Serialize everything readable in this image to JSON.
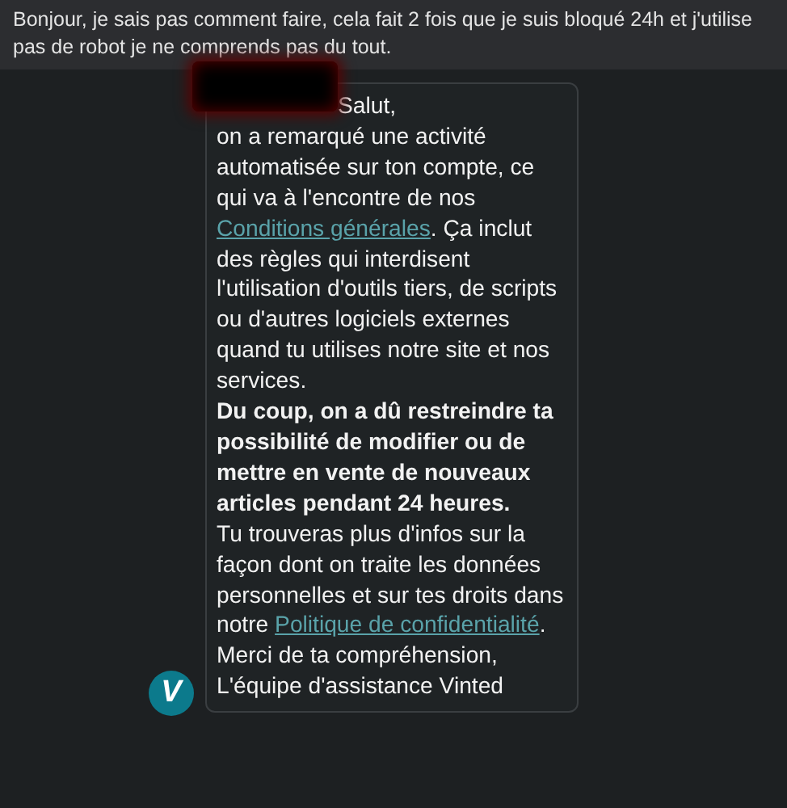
{
  "question": "Bonjour, je sais pas comment faire, cela fait 2 fois que je suis bloqué 24h et j'utilise pas de robot je ne comprends pas du tout.",
  "message": {
    "sender_redacted": true,
    "avatar_letter": "V",
    "paragraphs": [
      {
        "bold": false,
        "segments": [
          {
            "kind": "text",
            "text": "Salut,"
          }
        ]
      },
      {
        "bold": false,
        "segments": [
          {
            "kind": "text",
            "text": "on a remarqué une activité automatisée sur ton compte, ce qui va à l'encontre de nos "
          },
          {
            "kind": "link",
            "text": "Conditions générales"
          },
          {
            "kind": "text",
            "text": ". Ça inclut des règles qui interdisent l'utilisation d'outils tiers, de scripts ou d'autres logiciels externes quand tu utilises notre site et nos services."
          }
        ]
      },
      {
        "bold": true,
        "segments": [
          {
            "kind": "text",
            "text": "Du coup, on a dû restreindre ta possibilité de modifier ou de mettre en vente de nouveaux articles pendant 24 heures."
          }
        ]
      },
      {
        "bold": false,
        "segments": [
          {
            "kind": "text",
            "text": "Tu trouveras plus d'infos sur la façon dont on traite les données personnelles et sur tes droits dans notre "
          },
          {
            "kind": "link",
            "text": "Politique de confidentialité"
          },
          {
            "kind": "text",
            "text": "."
          }
        ]
      },
      {
        "bold": false,
        "segments": [
          {
            "kind": "text",
            "text": "Merci de ta compréhension,"
          }
        ]
      },
      {
        "bold": false,
        "segments": [
          {
            "kind": "text",
            "text": "L'équipe d'assistance Vinted"
          }
        ]
      }
    ]
  }
}
